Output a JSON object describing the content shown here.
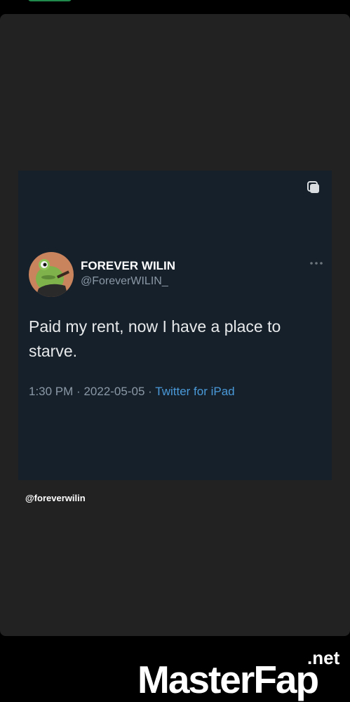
{
  "tweet": {
    "display_name": "FOREVER WILIN",
    "handle": "@ForeverWILIN_",
    "text": "Paid my rent, now I have a place to starve.",
    "time": "1:30 PM",
    "separator": "·",
    "date": "2022-05-05",
    "source": "Twitter for iPad"
  },
  "caption": "@foreverwilin",
  "watermark": {
    "master": "Master",
    "fap": "Fap",
    "net": ".net"
  },
  "colors": {
    "card_bg": "#15202b",
    "panel_bg": "#222222",
    "link": "#4a99d8",
    "muted": "#8b98a5"
  },
  "icons": {
    "copy": "copy-icon",
    "more": "more-icon",
    "avatar": "frog-avatar"
  }
}
